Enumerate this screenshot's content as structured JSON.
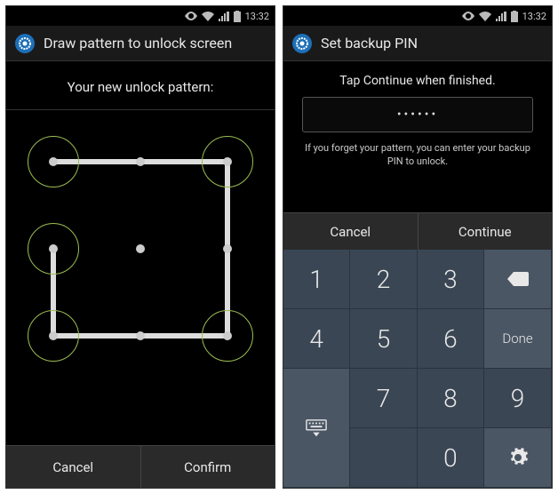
{
  "status": {
    "time": "13:32"
  },
  "left": {
    "header_title": "Draw pattern to unlock screen",
    "instruction": "Your new unlock pattern:",
    "cancel": "Cancel",
    "confirm": "Confirm",
    "pattern_sequence": [
      0,
      2,
      8,
      6,
      3
    ]
  },
  "right": {
    "header_title": "Set backup PIN",
    "subtitle": "Tap Continue when finished.",
    "pin_display": "••••••",
    "hint": "If you forget your pattern, you can enter your backup PIN to unlock.",
    "cancel": "Cancel",
    "continue": "Continue",
    "keypad": {
      "k1": "1",
      "k2": "2",
      "k3": "3",
      "k4": "4",
      "k5": "5",
      "k6": "6",
      "k7": "7",
      "k8": "8",
      "k9": "9",
      "k0": "0",
      "done": "Done"
    }
  }
}
